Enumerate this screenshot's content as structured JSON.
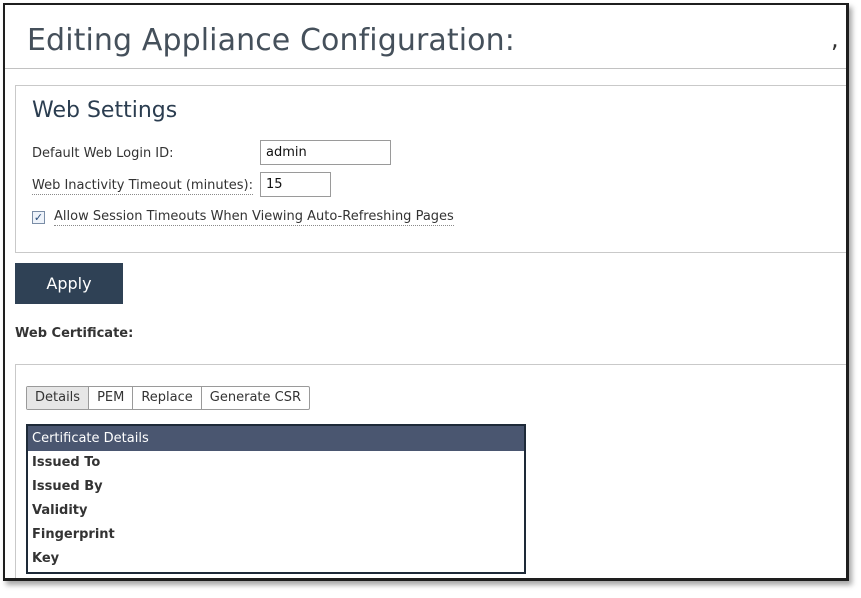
{
  "page": {
    "title": "Editing Appliance Configuration:",
    "title_suffix": ","
  },
  "web_settings": {
    "title": "Web Settings",
    "login_id_label": "Default Web Login ID:",
    "login_id_value": "admin",
    "timeout_label": "Web Inactivity Timeout (minutes):",
    "timeout_value": "15",
    "session_timeout_checkbox": {
      "label": "Allow Session Timeouts When Viewing Auto-Refreshing Pages",
      "checked": true
    }
  },
  "apply_button": "Apply",
  "web_certificate": {
    "heading": "Web Certificate:",
    "tabs": [
      "Details",
      "PEM",
      "Replace",
      "Generate CSR"
    ],
    "active_tab": "Details",
    "details_header": "Certificate Details",
    "rows": [
      "Issued To",
      "Issued By",
      "Validity",
      "Fingerprint",
      "Key"
    ]
  },
  "colors": {
    "apply_button_bg": "#2f4155",
    "table_header_bg": "#4a5670",
    "title_text": "#45505b"
  }
}
